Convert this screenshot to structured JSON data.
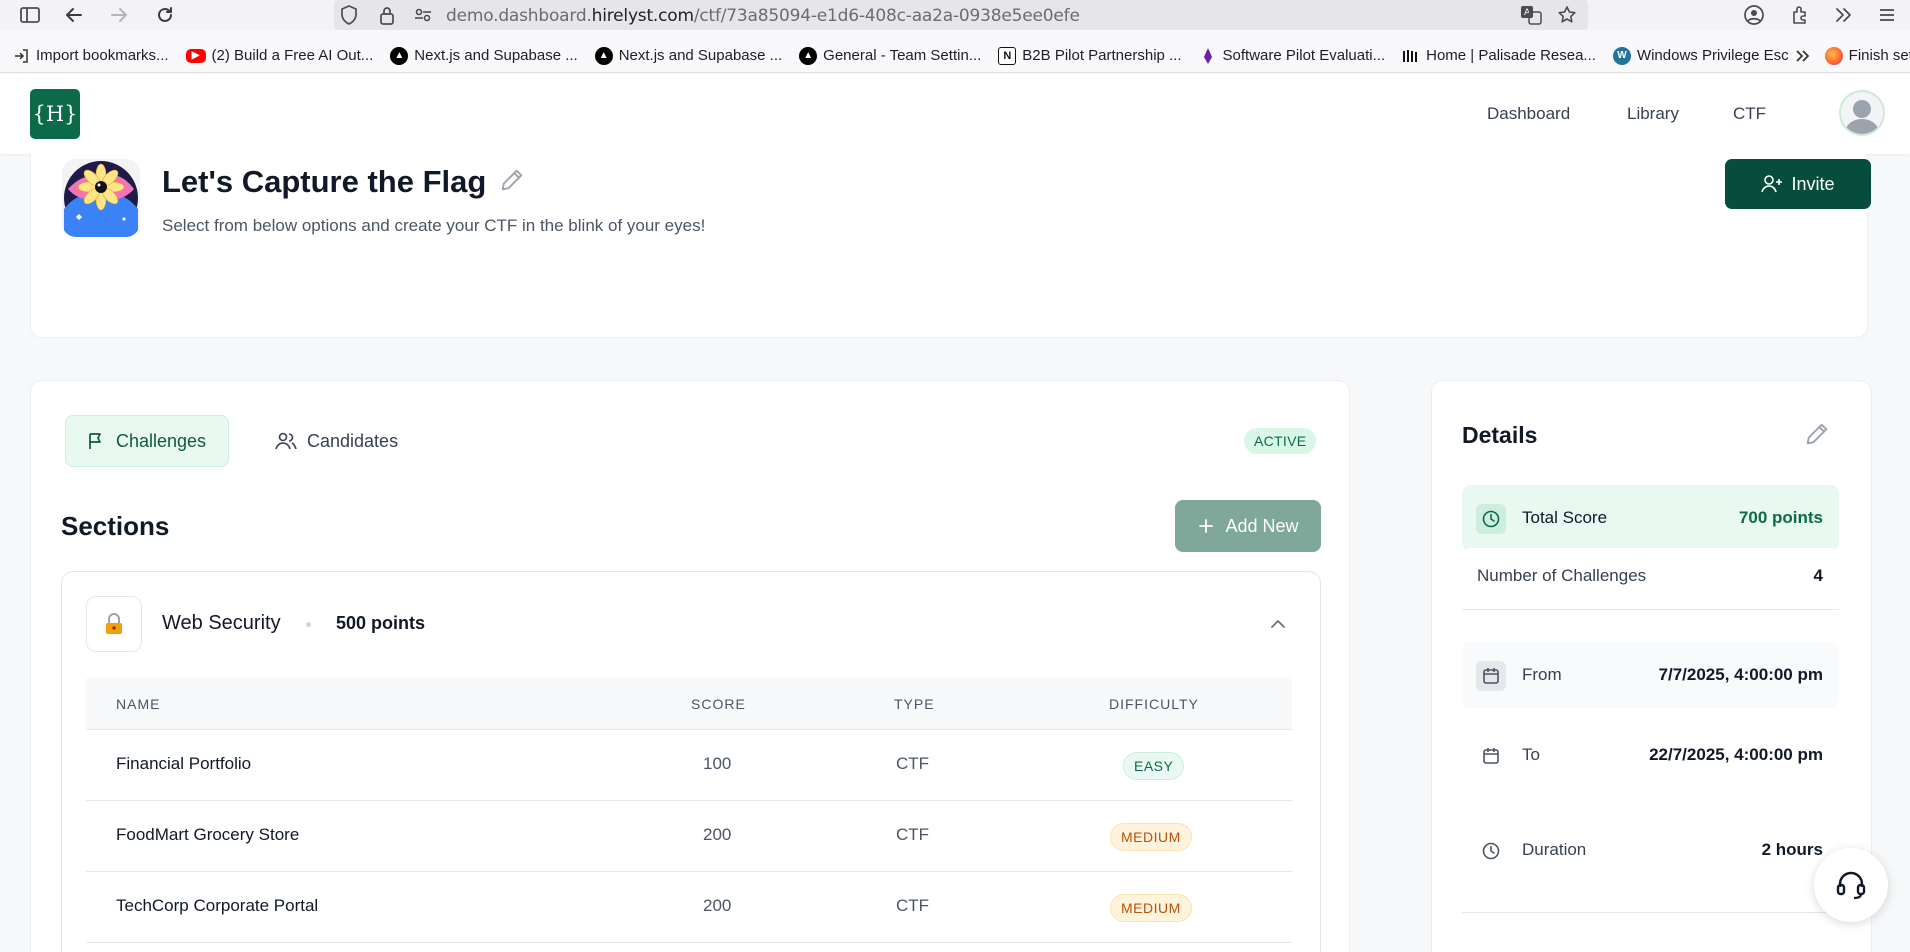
{
  "browser": {
    "url_prefix": "demo.dashboard.",
    "url_domain": "hirelyst.com",
    "url_path": "/ctf/73a85094-e1d6-408c-aa2a-0938e5ee0efe",
    "bookmarks": [
      {
        "label": "Import bookmarks...",
        "icon": "import-icon",
        "color": "#555555"
      },
      {
        "label": "(2) Build a Free AI Out...",
        "icon": "youtube-icon",
        "color": "#ff0000"
      },
      {
        "label": "Next.js and Supabase ...",
        "icon": "vercel-icon",
        "color": "#000000"
      },
      {
        "label": "Next.js and Supabase ...",
        "icon": "vercel-icon",
        "color": "#000000"
      },
      {
        "label": "General - Team Settin...",
        "icon": "vercel-icon",
        "color": "#000000"
      },
      {
        "label": "B2B Pilot Partnership ...",
        "icon": "notion-icon",
        "color": "#ffffff"
      },
      {
        "label": "Software Pilot Evaluati...",
        "icon": "pen-icon",
        "color": "#6b21a8"
      },
      {
        "label": "Home | Palisade Resea...",
        "icon": "palisade-icon",
        "color": "#111111"
      },
      {
        "label": "Windows Privilege Esc",
        "icon": "wordpress-icon",
        "color": "#21759b"
      }
    ],
    "overflow_label": "Finish setup"
  },
  "header": {
    "logo_text": "{H}",
    "nav": [
      "Dashboard",
      "Library",
      "CTF"
    ]
  },
  "hero": {
    "title": "Let's Capture the Flag",
    "subtitle": "Select from below options and create your CTF in the blink of your eyes!",
    "invite_label": "Invite"
  },
  "main": {
    "tabs": [
      "Challenges",
      "Candidates"
    ],
    "status_badge": "ACTIVE",
    "sections_title": "Sections",
    "add_new_label": "Add New",
    "section": {
      "icon": "lock-icon",
      "name": "Web Security",
      "points": "500 points"
    },
    "table": {
      "columns": [
        "NAME",
        "SCORE",
        "TYPE",
        "DIFFICULTY"
      ],
      "rows": [
        {
          "name": "Financial Portfolio",
          "score": "100",
          "type": "CTF",
          "difficulty": "EASY"
        },
        {
          "name": "FoodMart Grocery Store",
          "score": "200",
          "type": "CTF",
          "difficulty": "MEDIUM"
        },
        {
          "name": "TechCorp Corporate Portal",
          "score": "200",
          "type": "CTF",
          "difficulty": "MEDIUM"
        }
      ]
    }
  },
  "details": {
    "title": "Details",
    "total_score_label": "Total Score",
    "total_score_value": "700 points",
    "challenges_label": "Number of Challenges",
    "challenges_value": "4",
    "from_label": "From",
    "from_value": "7/7/2025, 4:00:00 pm",
    "to_label": "To",
    "to_value": "22/7/2025, 4:00:00 pm",
    "duration_label": "Duration",
    "duration_value": "2 hours"
  },
  "colors": {
    "brand": "#0b6b48",
    "brand_dark": "#064e3b",
    "add_button": "#7fa89a",
    "easy": "#0b6b48",
    "medium": "#b45309"
  }
}
